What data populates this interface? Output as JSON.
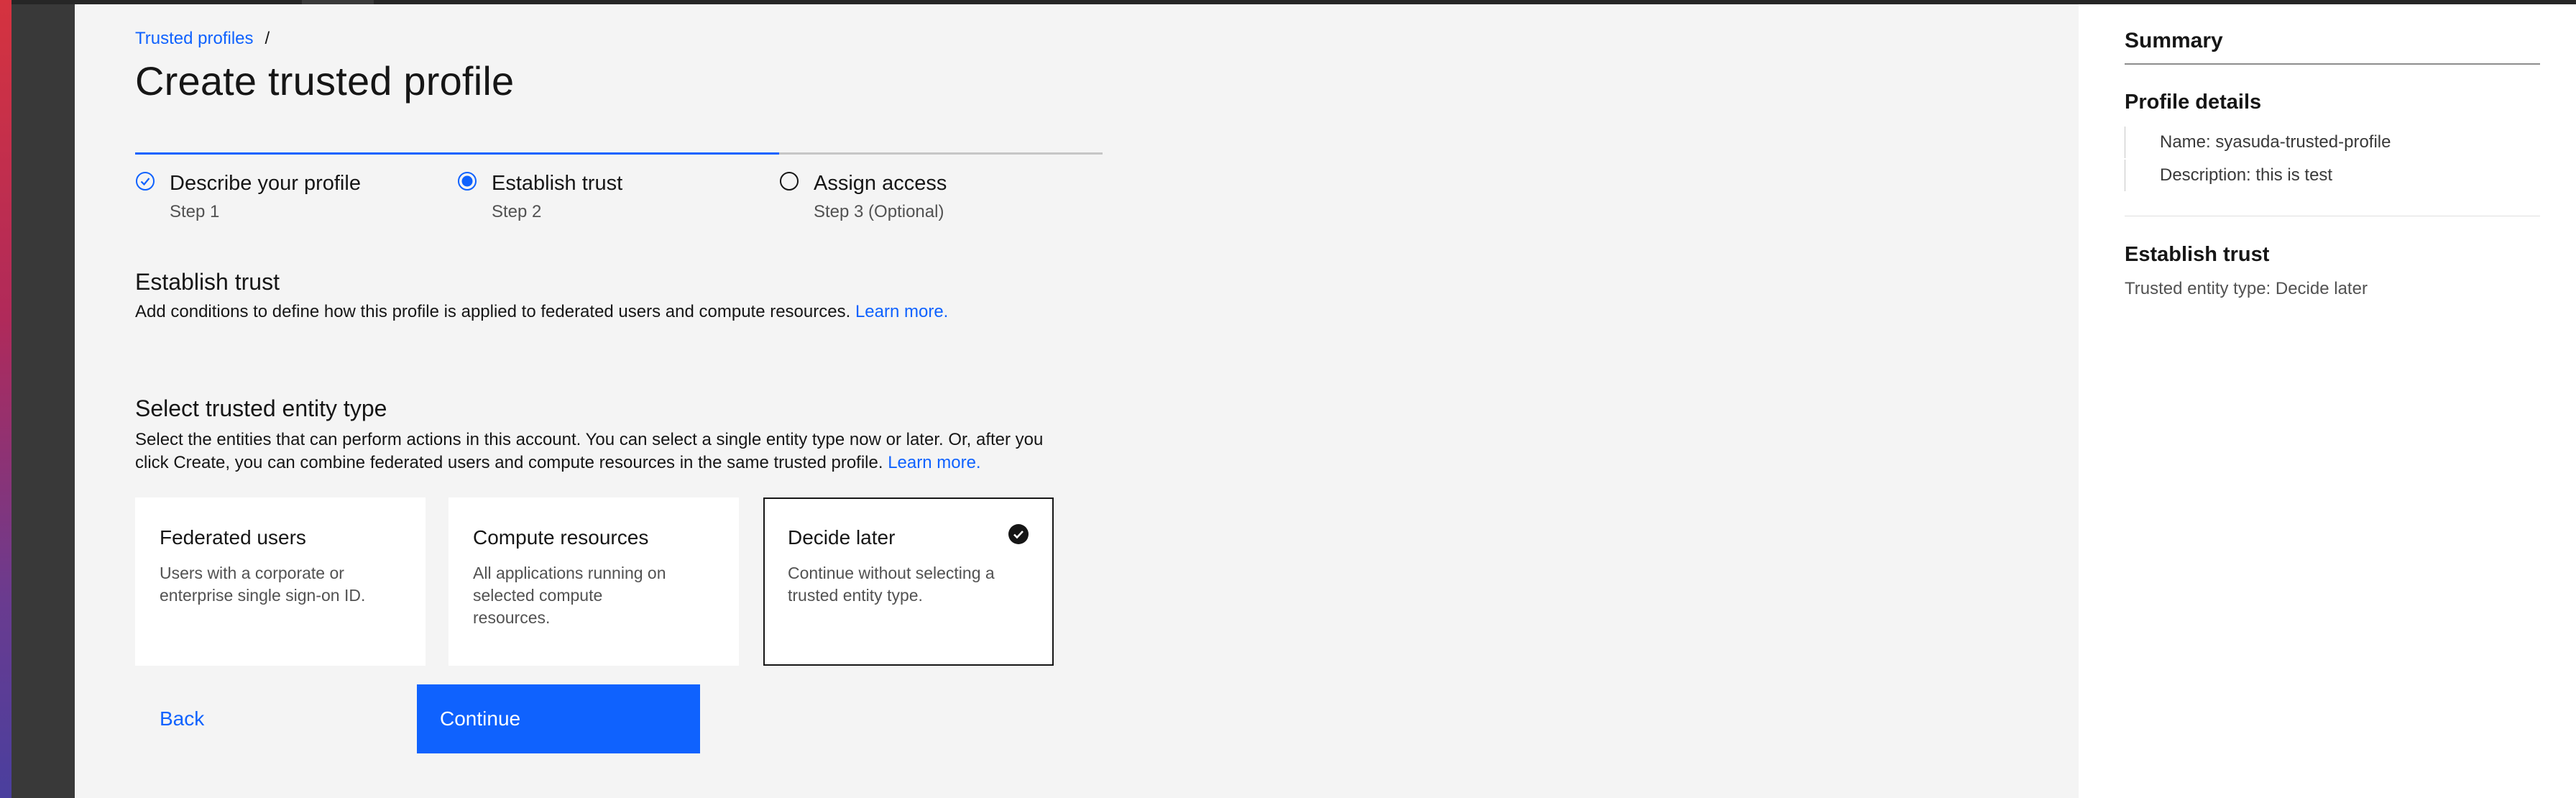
{
  "breadcrumb": {
    "parent": "Trusted profiles",
    "separator": "/"
  },
  "page": {
    "title": "Create trusted profile"
  },
  "steps": [
    {
      "label": "Describe your profile",
      "sub": "Step 1",
      "state": "complete"
    },
    {
      "label": "Establish trust",
      "sub": "Step 2",
      "state": "current"
    },
    {
      "label": "Assign access",
      "sub": "Step 3 (Optional)",
      "state": "incomplete"
    }
  ],
  "establish": {
    "title": "Establish trust",
    "desc": "Add conditions to define how this profile is applied to federated users and compute resources.",
    "learn_more": "Learn more."
  },
  "entity": {
    "title": "Select trusted entity type",
    "desc_line1": "Select the entities that can perform actions in this account. You can select a single entity type now or later. Or, after you",
    "desc_line2": "click Create, you can combine federated users and compute resources in the same trusted profile.",
    "learn_more": "Learn more."
  },
  "tiles": [
    {
      "title": "Federated users",
      "desc": "Users with a corporate or enterprise single sign-on ID.",
      "selected": false
    },
    {
      "title": "Compute resources",
      "desc": "All applications running on selected compute resources.",
      "selected": false
    },
    {
      "title": "Decide later",
      "desc": "Continue without selecting a trusted entity type.",
      "selected": true
    }
  ],
  "buttons": {
    "back": "Back",
    "continue": "Continue"
  },
  "summary": {
    "title": "Summary",
    "profile_details": "Profile details",
    "name": "Name: syasuda-trusted-profile",
    "description": "Description: this is test",
    "establish_trust": "Establish trust",
    "entity_type": "Trusted entity type: Decide later"
  },
  "colors": {
    "accent": "#0f62fe",
    "background": "#f4f4f4",
    "panel": "#ffffff",
    "rail": "#393939"
  },
  "icons": [
    "checkmark-outline-icon",
    "radio-selected-icon",
    "radio-empty-icon",
    "checkmark-filled-icon"
  ]
}
